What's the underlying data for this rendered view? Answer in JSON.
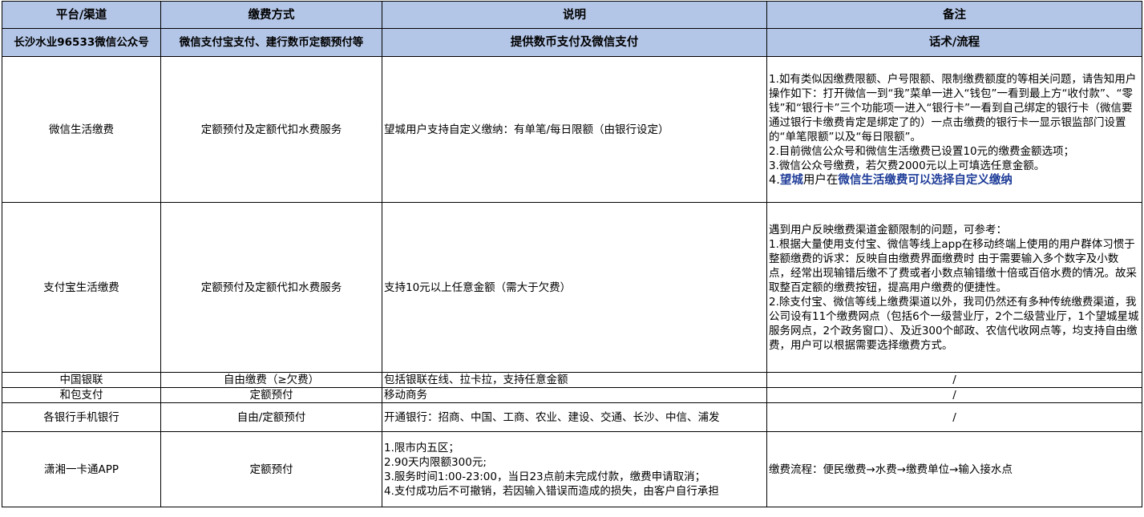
{
  "headers": {
    "row1": [
      "平台/渠道",
      "缴费方式",
      "说明",
      "备注"
    ],
    "row2": [
      "长沙水业96533微信公众号",
      "微信支付宝支付、建行数币定额预付等",
      "提供数币支付及微信支付",
      "话术/流程"
    ]
  },
  "rows": [
    {
      "platform": "微信生活缴费",
      "method": "定额预付及定额代扣水费服务",
      "desc": "望城用户支持自定义缴纳：有单笔/每日限额（由银行设定）",
      "note_lines": [
        "1.如有类似因缴费限额、户号限额、限制缴费额度的等相关问题，请告知用户操作如下：打开微信一到“我”菜单一进入“钱包”一看到最上方“收付款”、“零钱”和“银行卡”三个功能项一进入“银行卡”一看到自己绑定的银行卡（微信要通过银行卡缴费肯定是绑定了的）一点击缴费的银行卡一显示银监部门设置的“单笔限额”以及“每日限额”。",
        "2.目前微信公众号和微信生活缴费已设置10元的缴费金额选项；",
        "3.微信公众号缴费，若欠费2000元以上可填选任意金额。"
      ],
      "note_highlight": {
        "prefix": "4.",
        "part1": "望城",
        "part2": "用户在",
        "part3": "微信生活缴费可以选择自定义缴纳"
      }
    },
    {
      "platform": "支付宝生活缴费",
      "method": "定额预付及定额代扣水费服务",
      "desc": "支持10元以上任意金额（需大于欠费）",
      "note_lines": [
        "遇到用户反映缴费渠道金额限制的问题，可参考：",
        "1.根据大量使用支付宝、微信等线上app在移动终端上使用的用户群体习惯于整额缴费的诉求：反映自由缴费界面缴费时 由于需要输入多个数字及小数点，经常出现输错后缴不了费或者小数点输错缴十倍或百倍水费的情况。故采取整百定额的缴费按钮，提高用户缴费的便捷性。",
        "2.除支付宝、微信等线上缴费渠道以外，我司仍然还有多种传统缴费渠道，我公司设有11个缴费网点（包括6个一级营业厅，2个二级营业厅，1个望城星城服务网点，2个政务窗口）、及近300个邮政、农信代收网点等，均支持自由缴费，用户可以根据需要选择缴费方式。"
      ]
    },
    {
      "platform": "中国银联",
      "method": "自由缴费（≥欠费）",
      "desc": "包括银联在线、拉卡拉，支持任意金额",
      "note": "/"
    },
    {
      "platform": "和包支付",
      "method": "定额预付",
      "desc": "移动商务",
      "note": "/"
    },
    {
      "platform": "各银行手机银行",
      "method": "自由/定额预付",
      "desc": "开通银行：招商、中国、工商、农业、建设、交通、长沙、中信、浦发",
      "note": "/"
    },
    {
      "platform": "潇湘一卡通APP",
      "method": "定额预付",
      "desc_lines": [
        "1.限市内五区；",
        "2.90天内限额300元;",
        "3.服务时间1:00-23:00，当日23点前未完成付款，缴费申请取消；",
        "4.支付成功后不可撤销，若因输入错误而造成的损失，由客户自行承担"
      ],
      "note": "缴费流程：便民缴费→水费→缴费单位→输入接水点"
    }
  ],
  "colors": {
    "header_bg": "#b4c6e7",
    "highlight_text": "#1f3d99",
    "border": "#000000"
  }
}
